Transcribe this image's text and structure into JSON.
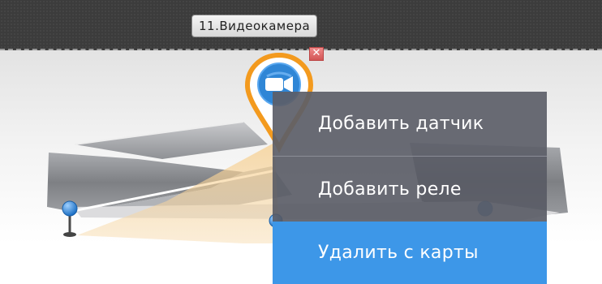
{
  "camera": {
    "label": "11.Видеокамера",
    "close_symbol": "✕"
  },
  "context_menu": {
    "items": [
      {
        "label": "Добавить датчик",
        "highlighted": false
      },
      {
        "label": "Добавить реле",
        "highlighted": false
      },
      {
        "label": "Удалить с карты",
        "highlighted": true
      }
    ],
    "highlight_color": "#3d97e8"
  },
  "icons": {
    "camera_pin": "video-camera-icon",
    "sensors": "sensor-pin-icon"
  },
  "colors": {
    "pin_ring": "#f39a1e",
    "pin_fill": "#2f86d6"
  }
}
